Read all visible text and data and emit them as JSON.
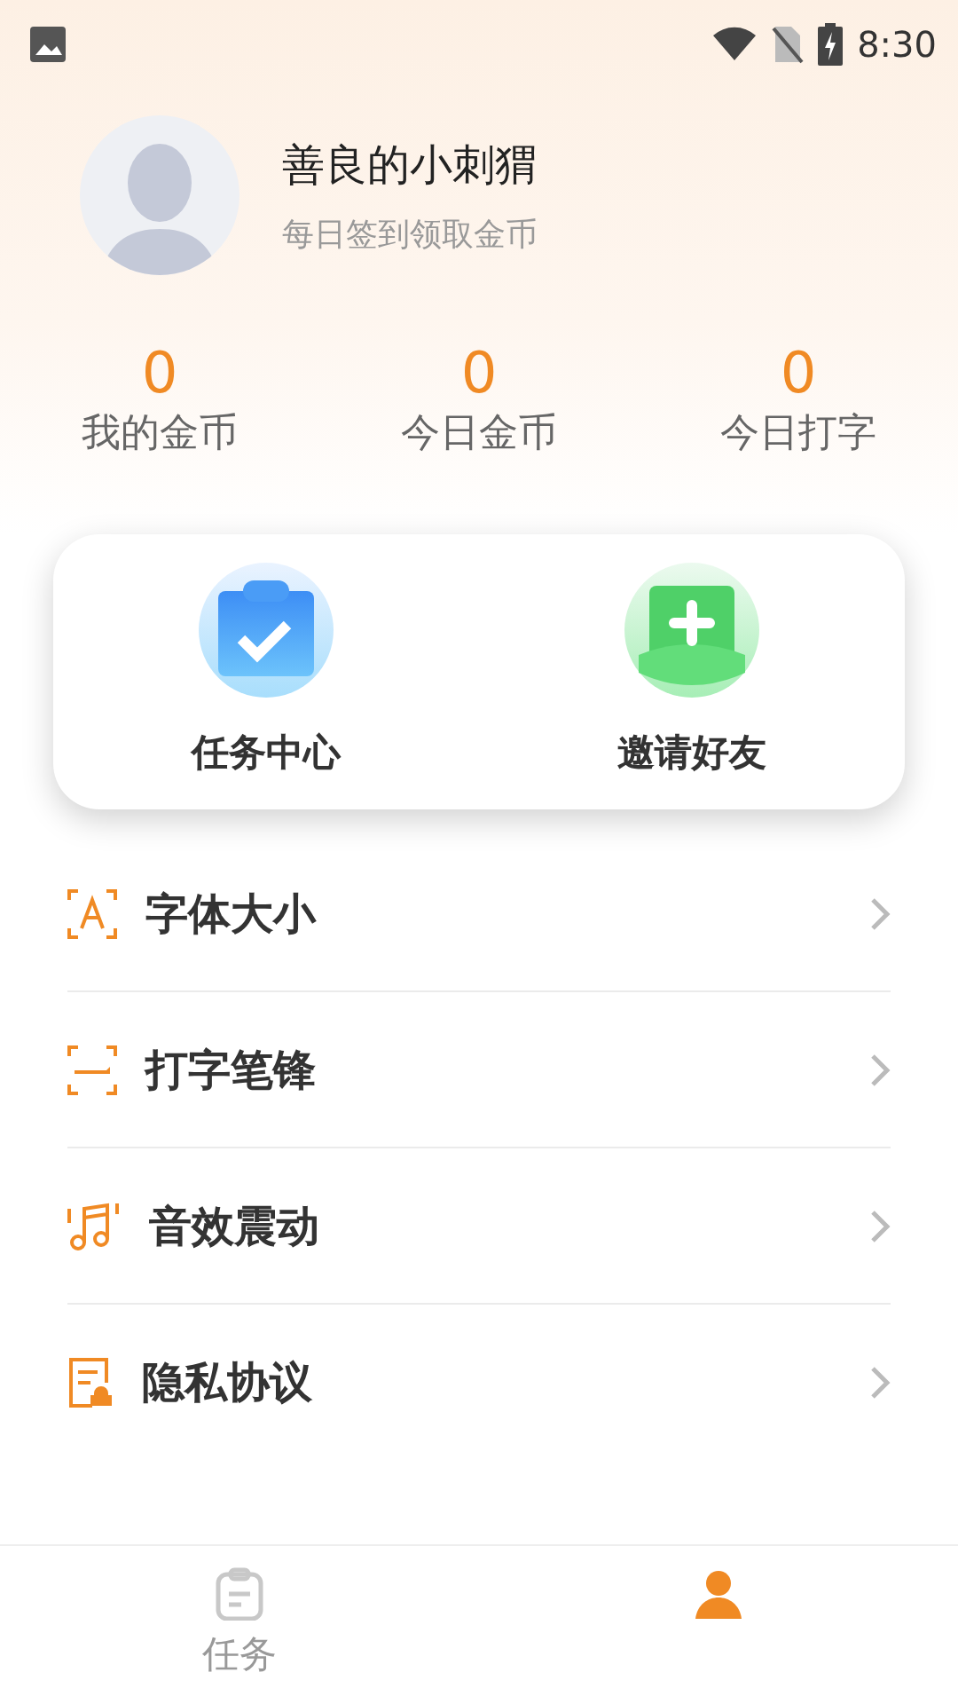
{
  "status_bar": {
    "time": "8:30"
  },
  "profile": {
    "name": "善良的小刺猬",
    "subtitle": "每日签到领取金币"
  },
  "stats": [
    {
      "value": "0",
      "label": "我的金币"
    },
    {
      "value": "0",
      "label": "今日金币"
    },
    {
      "value": "0",
      "label": "今日打字"
    }
  ],
  "actions": [
    {
      "kind": "tasks",
      "label": "任务中心"
    },
    {
      "kind": "invite",
      "label": "邀请好友"
    }
  ],
  "menu": [
    {
      "kind": "font",
      "label": "字体大小"
    },
    {
      "kind": "pen",
      "label": "打字笔锋"
    },
    {
      "kind": "sound",
      "label": "音效震动"
    },
    {
      "kind": "privacy",
      "label": "隐私协议"
    }
  ],
  "tabs": [
    {
      "kind": "tasks",
      "label": "任务",
      "selected": false
    },
    {
      "kind": "profile",
      "selected": true
    }
  ]
}
